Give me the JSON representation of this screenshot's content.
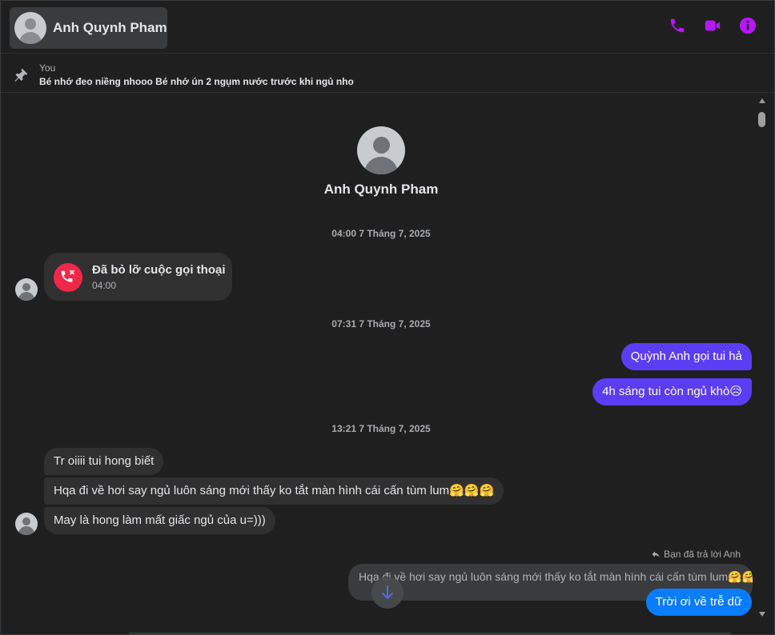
{
  "header": {
    "contact_name": "Anh Quynh Pham",
    "icons": [
      "phone-icon",
      "video-camera-icon",
      "info-icon"
    ],
    "accent_color": "#b517f5"
  },
  "pinned": {
    "author": "You",
    "text": "Bé nhớ đeo niềng nhooo Bé nhớ ún 2 ngụm nước trước khi ngủ nho"
  },
  "profile": {
    "name": "Anh Quynh Pham"
  },
  "timestamps": [
    "04:00 7 Tháng 7, 2025",
    "07:31 7 Tháng 7, 2025",
    "13:21 7 Tháng 7, 2025"
  ],
  "missed_call": {
    "title": "Đã bỏ lỡ cuộc gọi thoại",
    "time": "04:00"
  },
  "outgoing_1": [
    "Quỳnh Anh gọi tui hả",
    "4h sáng tui còn ngủ khò😥"
  ],
  "incoming_2": [
    "Tr oiiii tui hong biết",
    "Hqa đi về hơi say ngủ luôn sáng mới thấy ko tắt màn hình cái cấn tùm lum🤗🤗🤗",
    "May là hong làm mất giấc ngủ của u=)))"
  ],
  "reply": {
    "hint": "Bạn đã trả lời Anh",
    "quoted": "Hqa đi về hơi say ngủ luôn sáng mới thấy ko tắt màn hình cái cấn tùm lum🤗🤗🤗",
    "message": "Trời ơi về trễ dữ"
  },
  "colors": {
    "outgoing_bubble": "#5b3df5",
    "reply_bubble": "#0a7cff",
    "incoming_bubble": "#303030",
    "missed_call": "#f02849"
  }
}
